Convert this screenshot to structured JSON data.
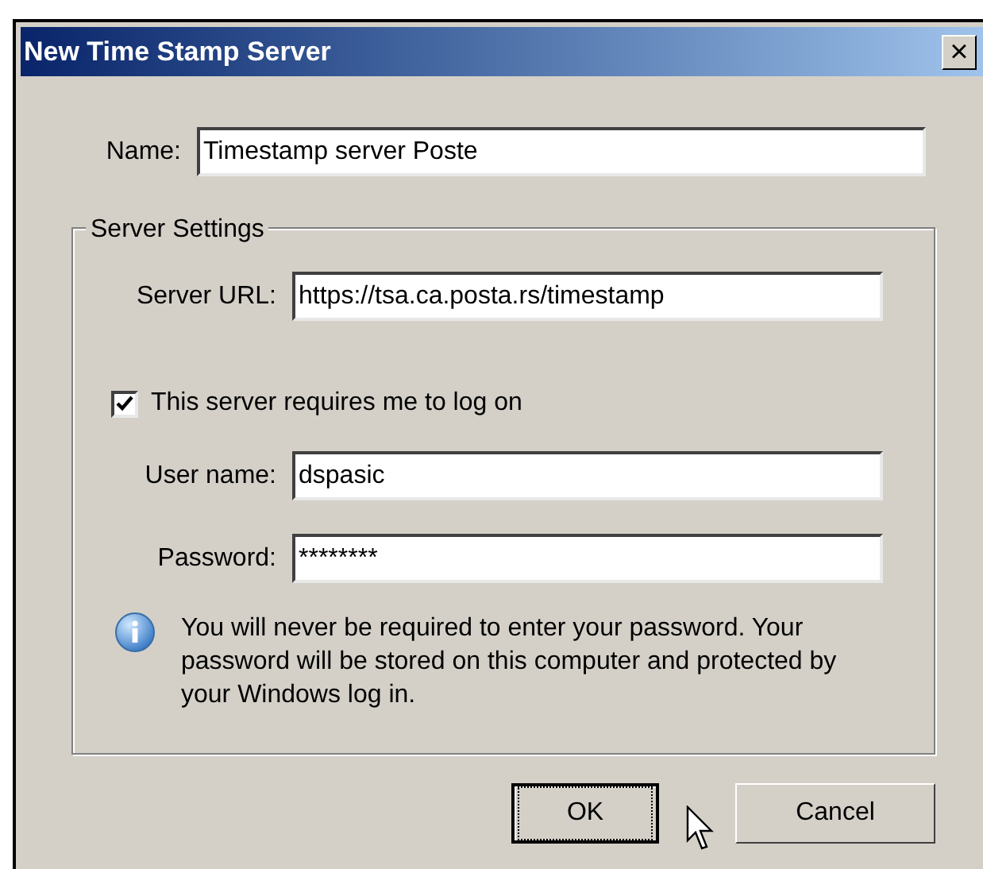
{
  "window": {
    "title": "New Time Stamp Server",
    "close": "×"
  },
  "name_field": {
    "label": "Name:",
    "value": "Timestamp server Poste"
  },
  "server_settings": {
    "legend": "Server Settings",
    "url_field": {
      "label": "Server URL:",
      "value": "https://tsa.ca.posta.rs/timestamp"
    },
    "logon_checkbox": {
      "label": "This server requires me to log on",
      "checked": true
    },
    "username_field": {
      "label": "User name:",
      "value": "dspasic"
    },
    "password_field": {
      "label": "Password:",
      "value": "********"
    },
    "info": "You will never be required to enter your password. Your password will be stored on this computer and protected by your Windows log in."
  },
  "buttons": [
    {
      "label": "OK",
      "focused": true
    },
    {
      "label": "Cancel",
      "focused": false
    }
  ]
}
